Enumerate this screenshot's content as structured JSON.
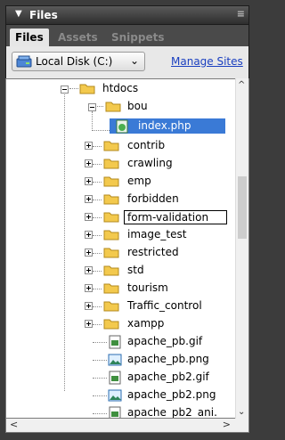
{
  "panel": {
    "title": "Files",
    "collapse_glyph": "▼",
    "options_glyph": "≡"
  },
  "tabs": [
    {
      "label": "Files",
      "active": true
    },
    {
      "label": "Assets",
      "active": false
    },
    {
      "label": "Snippets",
      "active": false
    }
  ],
  "toolbar": {
    "site_select": {
      "value": "Local Disk (C:)",
      "icon": "local-disk-icon"
    },
    "manage_sites_label": "Manage Sites"
  },
  "tree": {
    "items": [
      {
        "label": "htdocs",
        "type": "folder",
        "expander": "minus"
      },
      {
        "label": "bou",
        "type": "folder",
        "expander": "minus"
      },
      {
        "label": "index.php",
        "type": "php-file",
        "selected": true
      },
      {
        "label": "contrib",
        "type": "folder",
        "expander": "plus"
      },
      {
        "label": "crawling",
        "type": "folder",
        "expander": "plus"
      },
      {
        "label": "emp",
        "type": "folder",
        "expander": "plus"
      },
      {
        "label": "forbidden",
        "type": "folder",
        "expander": "plus"
      },
      {
        "label": "form-validation",
        "type": "folder",
        "expander": "plus",
        "editing": true
      },
      {
        "label": "image_test",
        "type": "folder",
        "expander": "plus"
      },
      {
        "label": "restricted",
        "type": "folder",
        "expander": "plus"
      },
      {
        "label": "std",
        "type": "folder",
        "expander": "plus"
      },
      {
        "label": "tourism",
        "type": "folder",
        "expander": "plus"
      },
      {
        "label": "Traffic_control",
        "type": "folder",
        "expander": "plus"
      },
      {
        "label": "xampp",
        "type": "folder",
        "expander": "plus"
      },
      {
        "label": "apache_pb.gif",
        "type": "gif-file"
      },
      {
        "label": "apache_pb.png",
        "type": "png-file"
      },
      {
        "label": "apache_pb2.gif",
        "type": "gif-file"
      },
      {
        "label": "apache_pb2.png",
        "type": "png-file"
      },
      {
        "label": "apache_pb2_ani.",
        "type": "gif-file"
      }
    ]
  },
  "colors": {
    "selection": "#3a7ad6",
    "link": "#1a3fc0",
    "panel_dark": "#3c3c3c",
    "folder": "#f3c94d"
  }
}
